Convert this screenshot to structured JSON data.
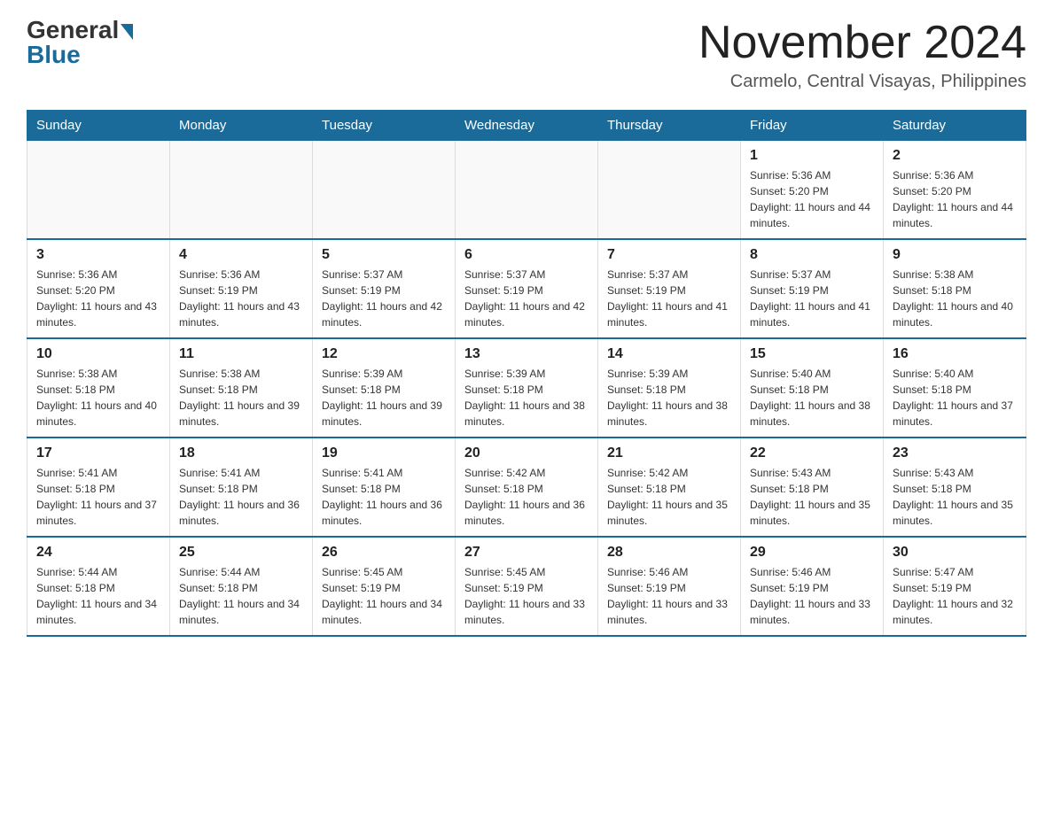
{
  "header": {
    "logo_general": "General",
    "logo_blue": "Blue",
    "month_title": "November 2024",
    "location": "Carmelo, Central Visayas, Philippines"
  },
  "weekdays": [
    "Sunday",
    "Monday",
    "Tuesday",
    "Wednesday",
    "Thursday",
    "Friday",
    "Saturday"
  ],
  "weeks": [
    [
      {
        "day": "",
        "sunrise": "",
        "sunset": "",
        "daylight": "",
        "empty": true
      },
      {
        "day": "",
        "sunrise": "",
        "sunset": "",
        "daylight": "",
        "empty": true
      },
      {
        "day": "",
        "sunrise": "",
        "sunset": "",
        "daylight": "",
        "empty": true
      },
      {
        "day": "",
        "sunrise": "",
        "sunset": "",
        "daylight": "",
        "empty": true
      },
      {
        "day": "",
        "sunrise": "",
        "sunset": "",
        "daylight": "",
        "empty": true
      },
      {
        "day": "1",
        "sunrise": "Sunrise: 5:36 AM",
        "sunset": "Sunset: 5:20 PM",
        "daylight": "Daylight: 11 hours and 44 minutes.",
        "empty": false
      },
      {
        "day": "2",
        "sunrise": "Sunrise: 5:36 AM",
        "sunset": "Sunset: 5:20 PM",
        "daylight": "Daylight: 11 hours and 44 minutes.",
        "empty": false
      }
    ],
    [
      {
        "day": "3",
        "sunrise": "Sunrise: 5:36 AM",
        "sunset": "Sunset: 5:20 PM",
        "daylight": "Daylight: 11 hours and 43 minutes.",
        "empty": false
      },
      {
        "day": "4",
        "sunrise": "Sunrise: 5:36 AM",
        "sunset": "Sunset: 5:19 PM",
        "daylight": "Daylight: 11 hours and 43 minutes.",
        "empty": false
      },
      {
        "day": "5",
        "sunrise": "Sunrise: 5:37 AM",
        "sunset": "Sunset: 5:19 PM",
        "daylight": "Daylight: 11 hours and 42 minutes.",
        "empty": false
      },
      {
        "day": "6",
        "sunrise": "Sunrise: 5:37 AM",
        "sunset": "Sunset: 5:19 PM",
        "daylight": "Daylight: 11 hours and 42 minutes.",
        "empty": false
      },
      {
        "day": "7",
        "sunrise": "Sunrise: 5:37 AM",
        "sunset": "Sunset: 5:19 PM",
        "daylight": "Daylight: 11 hours and 41 minutes.",
        "empty": false
      },
      {
        "day": "8",
        "sunrise": "Sunrise: 5:37 AM",
        "sunset": "Sunset: 5:19 PM",
        "daylight": "Daylight: 11 hours and 41 minutes.",
        "empty": false
      },
      {
        "day": "9",
        "sunrise": "Sunrise: 5:38 AM",
        "sunset": "Sunset: 5:18 PM",
        "daylight": "Daylight: 11 hours and 40 minutes.",
        "empty": false
      }
    ],
    [
      {
        "day": "10",
        "sunrise": "Sunrise: 5:38 AM",
        "sunset": "Sunset: 5:18 PM",
        "daylight": "Daylight: 11 hours and 40 minutes.",
        "empty": false
      },
      {
        "day": "11",
        "sunrise": "Sunrise: 5:38 AM",
        "sunset": "Sunset: 5:18 PM",
        "daylight": "Daylight: 11 hours and 39 minutes.",
        "empty": false
      },
      {
        "day": "12",
        "sunrise": "Sunrise: 5:39 AM",
        "sunset": "Sunset: 5:18 PM",
        "daylight": "Daylight: 11 hours and 39 minutes.",
        "empty": false
      },
      {
        "day": "13",
        "sunrise": "Sunrise: 5:39 AM",
        "sunset": "Sunset: 5:18 PM",
        "daylight": "Daylight: 11 hours and 38 minutes.",
        "empty": false
      },
      {
        "day": "14",
        "sunrise": "Sunrise: 5:39 AM",
        "sunset": "Sunset: 5:18 PM",
        "daylight": "Daylight: 11 hours and 38 minutes.",
        "empty": false
      },
      {
        "day": "15",
        "sunrise": "Sunrise: 5:40 AM",
        "sunset": "Sunset: 5:18 PM",
        "daylight": "Daylight: 11 hours and 38 minutes.",
        "empty": false
      },
      {
        "day": "16",
        "sunrise": "Sunrise: 5:40 AM",
        "sunset": "Sunset: 5:18 PM",
        "daylight": "Daylight: 11 hours and 37 minutes.",
        "empty": false
      }
    ],
    [
      {
        "day": "17",
        "sunrise": "Sunrise: 5:41 AM",
        "sunset": "Sunset: 5:18 PM",
        "daylight": "Daylight: 11 hours and 37 minutes.",
        "empty": false
      },
      {
        "day": "18",
        "sunrise": "Sunrise: 5:41 AM",
        "sunset": "Sunset: 5:18 PM",
        "daylight": "Daylight: 11 hours and 36 minutes.",
        "empty": false
      },
      {
        "day": "19",
        "sunrise": "Sunrise: 5:41 AM",
        "sunset": "Sunset: 5:18 PM",
        "daylight": "Daylight: 11 hours and 36 minutes.",
        "empty": false
      },
      {
        "day": "20",
        "sunrise": "Sunrise: 5:42 AM",
        "sunset": "Sunset: 5:18 PM",
        "daylight": "Daylight: 11 hours and 36 minutes.",
        "empty": false
      },
      {
        "day": "21",
        "sunrise": "Sunrise: 5:42 AM",
        "sunset": "Sunset: 5:18 PM",
        "daylight": "Daylight: 11 hours and 35 minutes.",
        "empty": false
      },
      {
        "day": "22",
        "sunrise": "Sunrise: 5:43 AM",
        "sunset": "Sunset: 5:18 PM",
        "daylight": "Daylight: 11 hours and 35 minutes.",
        "empty": false
      },
      {
        "day": "23",
        "sunrise": "Sunrise: 5:43 AM",
        "sunset": "Sunset: 5:18 PM",
        "daylight": "Daylight: 11 hours and 35 minutes.",
        "empty": false
      }
    ],
    [
      {
        "day": "24",
        "sunrise": "Sunrise: 5:44 AM",
        "sunset": "Sunset: 5:18 PM",
        "daylight": "Daylight: 11 hours and 34 minutes.",
        "empty": false
      },
      {
        "day": "25",
        "sunrise": "Sunrise: 5:44 AM",
        "sunset": "Sunset: 5:18 PM",
        "daylight": "Daylight: 11 hours and 34 minutes.",
        "empty": false
      },
      {
        "day": "26",
        "sunrise": "Sunrise: 5:45 AM",
        "sunset": "Sunset: 5:19 PM",
        "daylight": "Daylight: 11 hours and 34 minutes.",
        "empty": false
      },
      {
        "day": "27",
        "sunrise": "Sunrise: 5:45 AM",
        "sunset": "Sunset: 5:19 PM",
        "daylight": "Daylight: 11 hours and 33 minutes.",
        "empty": false
      },
      {
        "day": "28",
        "sunrise": "Sunrise: 5:46 AM",
        "sunset": "Sunset: 5:19 PM",
        "daylight": "Daylight: 11 hours and 33 minutes.",
        "empty": false
      },
      {
        "day": "29",
        "sunrise": "Sunrise: 5:46 AM",
        "sunset": "Sunset: 5:19 PM",
        "daylight": "Daylight: 11 hours and 33 minutes.",
        "empty": false
      },
      {
        "day": "30",
        "sunrise": "Sunrise: 5:47 AM",
        "sunset": "Sunset: 5:19 PM",
        "daylight": "Daylight: 11 hours and 32 minutes.",
        "empty": false
      }
    ]
  ]
}
